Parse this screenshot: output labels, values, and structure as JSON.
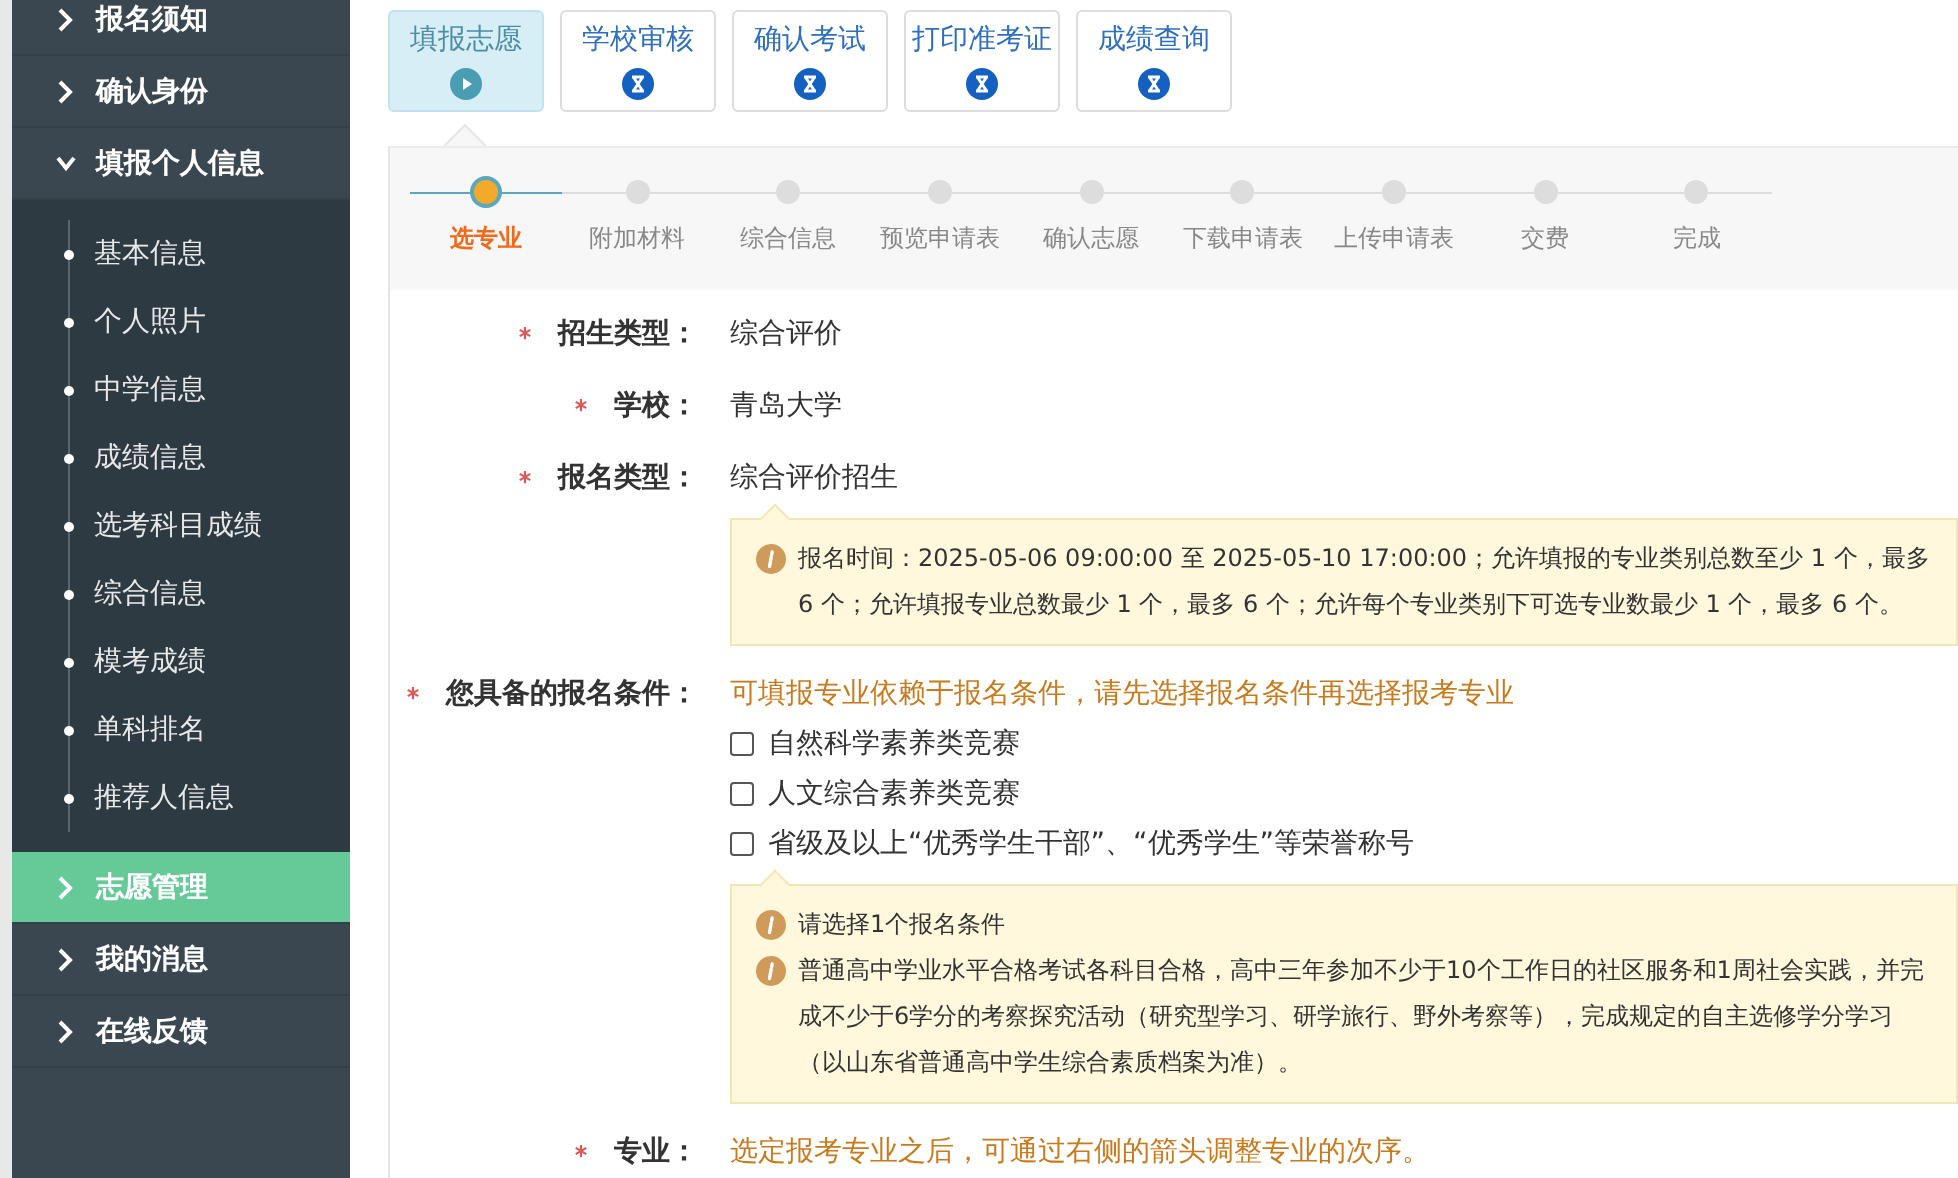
{
  "sidebar": {
    "items": [
      {
        "label": "报名须知",
        "selected": false,
        "expanded": false
      },
      {
        "label": "确认身份",
        "selected": false,
        "expanded": false
      },
      {
        "label": "填报个人信息",
        "selected": false,
        "expanded": true,
        "children": [
          {
            "label": "基本信息"
          },
          {
            "label": "个人照片"
          },
          {
            "label": "中学信息"
          },
          {
            "label": "成绩信息"
          },
          {
            "label": "选考科目成绩"
          },
          {
            "label": "综合信息"
          },
          {
            "label": "模考成绩"
          },
          {
            "label": "单科排名"
          },
          {
            "label": "推荐人信息"
          }
        ]
      },
      {
        "label": "志愿管理",
        "selected": true,
        "expanded": false
      },
      {
        "label": "我的消息",
        "selected": false,
        "expanded": false
      },
      {
        "label": "在线反馈",
        "selected": false,
        "expanded": false
      }
    ]
  },
  "tabs": [
    {
      "label": "填报志愿",
      "selected": true
    },
    {
      "label": "学校审核",
      "selected": false
    },
    {
      "label": "确认考试",
      "selected": false
    },
    {
      "label": "打印准考证",
      "selected": false
    },
    {
      "label": "成绩查询",
      "selected": false
    }
  ],
  "steps": [
    {
      "label": "选专业",
      "selected": true
    },
    {
      "label": "附加材料",
      "selected": false
    },
    {
      "label": "综合信息",
      "selected": false
    },
    {
      "label": "预览申请表",
      "selected": false
    },
    {
      "label": "确认志愿",
      "selected": false
    },
    {
      "label": "下载申请表",
      "selected": false
    },
    {
      "label": "上传申请表",
      "selected": false
    },
    {
      "label": "交费",
      "selected": false
    },
    {
      "label": "完成",
      "selected": false
    }
  ],
  "form": [
    {
      "label": "招生类型：",
      "required": true,
      "value": "综合评价"
    },
    {
      "label": "学校：",
      "required": true,
      "value": "青岛大学"
    },
    {
      "label": "报名类型：",
      "required": true,
      "value": "综合评价招生",
      "notes": [
        "报名时间：2025-05-06 09:00:00 至 2025-05-10 17:00:00；允许填报的专业类别总数至少 1 个，最多 6 个；允许填报专业总数最少 1 个，最多 6 个；允许每个专业类别下可选专业数最少 1 个，最多 6 个。"
      ]
    },
    {
      "label": "您具备的报名条件：",
      "required": true,
      "hint": "可填报专业依赖于报名条件，请先选择报名条件再选择报考专业",
      "options": [
        {
          "label": "自然科学素养类竞赛",
          "checked": false
        },
        {
          "label": "人文综合素养类竞赛",
          "checked": false
        },
        {
          "label": "省级及以上“优秀学生干部”、“优秀学生”等荣誉称号",
          "checked": false
        }
      ],
      "notes": [
        "请选择1个报名条件",
        "普通高中学业水平合格考试各科目合格，高中三年参加不少于10个工作日的社区服务和1周社会实践，并完成不少于6学分的考察探究活动（研究型学习、研学旅行、野外考察等），完成规定的自主选修学分学习（以山东省普通高中学生综合素质档案为准）。"
      ]
    },
    {
      "label": "专业：",
      "required": true,
      "hint": "选定报考专业之后，可通过右侧的箭头调整专业的次序。"
    }
  ]
}
